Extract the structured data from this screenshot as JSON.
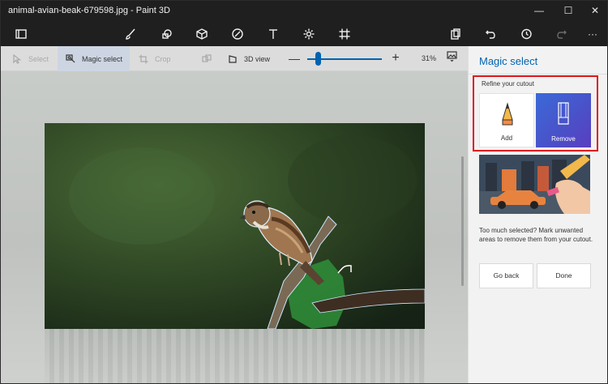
{
  "window": {
    "title": "animal-avian-beak-679598.jpg - Paint 3D",
    "controls": {
      "minimize": "—",
      "maximize": "☐",
      "close": "✕"
    }
  },
  "toolbar": {
    "icons": [
      "menu-icon",
      "brushes-icon",
      "2d-shapes-icon",
      "3d-shapes-icon",
      "stickers-icon",
      "text-icon",
      "effects-icon",
      "canvas-icon",
      "paste-icon",
      "undo-icon",
      "history-icon",
      "redo-icon",
      "more-icon"
    ],
    "more_label": "···"
  },
  "subbar": {
    "select_label": "Select",
    "magic_select_label": "Magic select",
    "crop_label": "Crop",
    "view3d_label": "3D view",
    "zoom_minus": "—",
    "zoom_plus": "+",
    "zoom_value": "31%",
    "zoom_level_fraction": 0.12
  },
  "panel": {
    "title": "Magic select",
    "refine_label": "Refine your cutout",
    "add_label": "Add",
    "remove_label": "Remove",
    "help_text": "Too much selected? Mark unwanted areas to remove them from your cutout.",
    "go_back_label": "Go back",
    "done_label": "Done"
  },
  "colors": {
    "accent": "#0063b1",
    "highlight_border": "#e0141b",
    "remove_gradient_start": "#3a6ad8",
    "remove_gradient_end": "#5a3ec0"
  }
}
